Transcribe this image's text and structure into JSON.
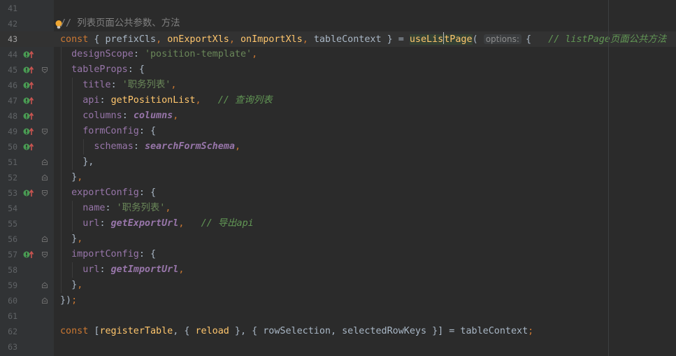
{
  "editor": {
    "language": "typescript",
    "colors": {
      "background": "#2b2b2b",
      "gutter": "#313335",
      "keyword": "#cc7832",
      "function": "#ffc66d",
      "property": "#9876aa",
      "string": "#6a8759",
      "comment": "#629755",
      "plain": "#a9b7c6"
    },
    "current_line": 43,
    "lines": [
      {
        "num": "41",
        "tokens": []
      },
      {
        "num": "42",
        "tokens": [
          {
            "t": "// ",
            "c": "c-cmtp"
          },
          {
            "t": "列表页面公共参数、方法",
            "c": "c-cmtp"
          }
        ],
        "bulb": true
      },
      {
        "num": "43",
        "current": true,
        "tokens": [
          {
            "t": "const",
            "c": "c-kw"
          },
          {
            "t": " { prefixCls",
            "c": "c-id"
          },
          {
            "t": ", ",
            "c": "c-kw"
          },
          {
            "t": "onExportXls",
            "c": "c-fn"
          },
          {
            "t": ", ",
            "c": "c-kw"
          },
          {
            "t": "onImportXls",
            "c": "c-fn"
          },
          {
            "t": ", ",
            "c": "c-kw"
          },
          {
            "t": "tableContext } = ",
            "c": "c-id"
          },
          {
            "t": "useLis",
            "c": "c-hl"
          },
          {
            "caret": true
          },
          {
            "t": "tPage",
            "c": "c-hl"
          },
          {
            "t": "( ",
            "c": "c-id"
          },
          {
            "t": "options:",
            "c": "hint"
          },
          {
            "t": "{   ",
            "c": "c-id"
          },
          {
            "t": "// listPage页面公共方法",
            "c": "c-cmt"
          }
        ]
      },
      {
        "num": "44",
        "impl": true,
        "tokens": [
          {
            "t": "  designScope",
            "c": "c-prop"
          },
          {
            "t": ": ",
            "c": "c-id"
          },
          {
            "t": "'position-template'",
            "c": "c-str"
          },
          {
            "t": ",",
            "c": "c-kw"
          }
        ]
      },
      {
        "num": "45",
        "impl": true,
        "fold": "open",
        "tokens": [
          {
            "t": "  tableProps",
            "c": "c-prop"
          },
          {
            "t": ": {",
            "c": "c-id"
          }
        ]
      },
      {
        "num": "46",
        "impl": true,
        "tokens": [
          {
            "t": "    title",
            "c": "c-prop"
          },
          {
            "t": ": ",
            "c": "c-id"
          },
          {
            "t": "'职务列表'",
            "c": "c-str"
          },
          {
            "t": ",",
            "c": "c-kw"
          }
        ]
      },
      {
        "num": "47",
        "impl": true,
        "tokens": [
          {
            "t": "    api",
            "c": "c-prop"
          },
          {
            "t": ": ",
            "c": "c-id"
          },
          {
            "t": "getPositionList",
            "c": "c-fn"
          },
          {
            "t": ",",
            "c": "c-kw"
          },
          {
            "t": "   ",
            "c": "c-id"
          },
          {
            "t": "// 查询列表",
            "c": "c-cmt"
          }
        ]
      },
      {
        "num": "48",
        "impl": true,
        "tokens": [
          {
            "t": "    columns",
            "c": "c-prop"
          },
          {
            "t": ": ",
            "c": "c-id"
          },
          {
            "t": "columns",
            "c": "c-var"
          },
          {
            "t": ",",
            "c": "c-kw"
          }
        ]
      },
      {
        "num": "49",
        "impl": true,
        "fold": "open",
        "tokens": [
          {
            "t": "    formConfig",
            "c": "c-prop"
          },
          {
            "t": ": {",
            "c": "c-id"
          }
        ]
      },
      {
        "num": "50",
        "impl": true,
        "tokens": [
          {
            "t": "      schemas",
            "c": "c-prop"
          },
          {
            "t": ": ",
            "c": "c-id"
          },
          {
            "t": "searchFormSchema",
            "c": "c-var"
          },
          {
            "t": ",",
            "c": "c-kw"
          }
        ]
      },
      {
        "num": "51",
        "fold": "close",
        "tokens": [
          {
            "t": "    },",
            "c": "c-id"
          }
        ]
      },
      {
        "num": "52",
        "fold": "close",
        "tokens": [
          {
            "t": "  }",
            "c": "c-id"
          },
          {
            "t": ",",
            "c": "c-kw"
          }
        ]
      },
      {
        "num": "53",
        "impl": true,
        "fold": "open",
        "tokens": [
          {
            "t": "  exportConfig",
            "c": "c-prop"
          },
          {
            "t": ": {",
            "c": "c-id"
          }
        ]
      },
      {
        "num": "54",
        "tokens": [
          {
            "t": "    name",
            "c": "c-prop"
          },
          {
            "t": ": ",
            "c": "c-id"
          },
          {
            "t": "'职务列表'",
            "c": "c-str"
          },
          {
            "t": ",",
            "c": "c-kw"
          }
        ]
      },
      {
        "num": "55",
        "tokens": [
          {
            "t": "    url",
            "c": "c-prop"
          },
          {
            "t": ": ",
            "c": "c-id"
          },
          {
            "t": "getExportUrl",
            "c": "c-var"
          },
          {
            "t": ",",
            "c": "c-kw"
          },
          {
            "t": "   ",
            "c": "c-id"
          },
          {
            "t": "// 导出api",
            "c": "c-cmt"
          }
        ]
      },
      {
        "num": "56",
        "fold": "close",
        "tokens": [
          {
            "t": "  }",
            "c": "c-id"
          },
          {
            "t": ",",
            "c": "c-kw"
          }
        ]
      },
      {
        "num": "57",
        "impl": true,
        "fold": "open",
        "tokens": [
          {
            "t": "  importConfig",
            "c": "c-prop"
          },
          {
            "t": ": {",
            "c": "c-id"
          }
        ]
      },
      {
        "num": "58",
        "tokens": [
          {
            "t": "    url",
            "c": "c-prop"
          },
          {
            "t": ": ",
            "c": "c-id"
          },
          {
            "t": "getImportUrl",
            "c": "c-var"
          },
          {
            "t": ",",
            "c": "c-kw"
          }
        ]
      },
      {
        "num": "59",
        "fold": "close",
        "tokens": [
          {
            "t": "  }",
            "c": "c-id"
          },
          {
            "t": ",",
            "c": "c-kw"
          }
        ]
      },
      {
        "num": "60",
        "fold": "close",
        "tokens": [
          {
            "t": "})",
            "c": "c-id"
          },
          {
            "t": ";",
            "c": "c-kw"
          }
        ]
      },
      {
        "num": "61",
        "tokens": []
      },
      {
        "num": "62",
        "tokens": [
          {
            "t": "const",
            "c": "c-kw"
          },
          {
            "t": " [",
            "c": "c-id"
          },
          {
            "t": "registerTable",
            "c": "c-fn"
          },
          {
            "t": ", { ",
            "c": "c-id"
          },
          {
            "t": "reload",
            "c": "c-fn"
          },
          {
            "t": " }, { rowSelection, selectedRowKeys }] = tableContext",
            "c": "c-id"
          },
          {
            "t": ";",
            "c": "c-kw"
          }
        ]
      },
      {
        "num": "63",
        "tokens": []
      }
    ]
  }
}
